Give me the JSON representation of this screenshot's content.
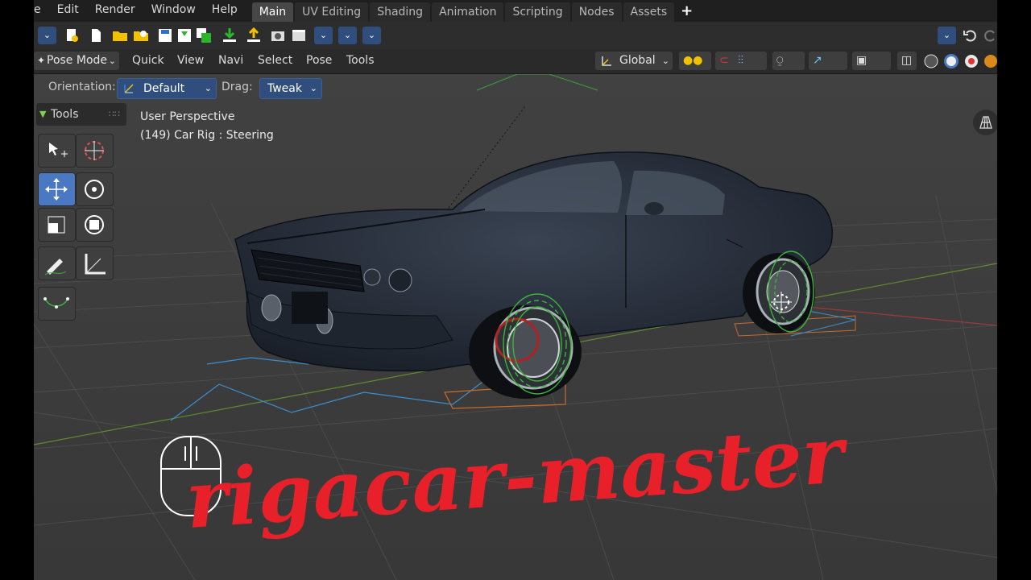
{
  "menubar": {
    "items": [
      "e",
      "Edit",
      "Render",
      "Window",
      "Help"
    ],
    "workspaces": [
      {
        "label": "Main",
        "active": true
      },
      {
        "label": "UV Editing",
        "active": false
      },
      {
        "label": "Shading",
        "active": false
      },
      {
        "label": "Animation",
        "active": false
      },
      {
        "label": "Scripting",
        "active": false
      },
      {
        "label": "Nodes",
        "active": false
      },
      {
        "label": "Assets",
        "active": false
      }
    ],
    "add_tab": "+"
  },
  "header": {
    "mode": "Pose Mode",
    "menus": [
      "Quick",
      "View",
      "Navi",
      "Select",
      "Pose",
      "Tools"
    ],
    "transform_orientation": "Global"
  },
  "tool_settings": {
    "orientation_label": "Orientation:",
    "orientation_value": "Default",
    "drag_label": "Drag:",
    "drag_value": "Tweak"
  },
  "tools_panel": {
    "title": "Tools"
  },
  "viewport": {
    "view_name": "User Perspective",
    "object_info": "(149) Car Rig : Steering"
  },
  "watermark": {
    "text": "rigacar-master"
  },
  "colors": {
    "accent": "#4a78c2",
    "watermark": "#e8202a",
    "rig": "#3bb33b"
  }
}
